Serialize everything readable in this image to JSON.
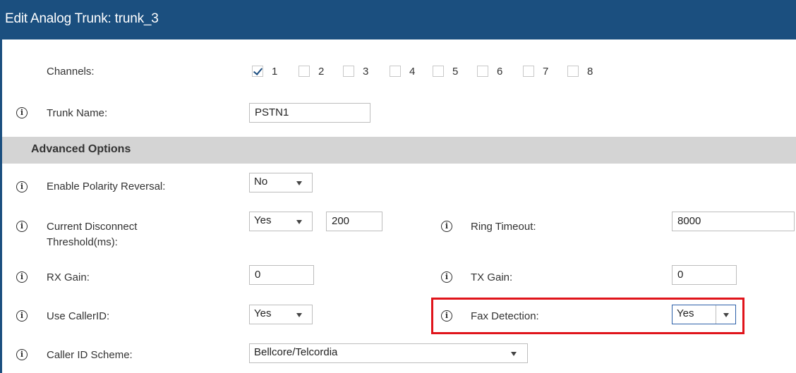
{
  "header": {
    "title": "Edit Analog Trunk: trunk_3"
  },
  "channels": {
    "label": "Channels:",
    "items": [
      {
        "num": "1",
        "checked": true
      },
      {
        "num": "2",
        "checked": false
      },
      {
        "num": "3",
        "checked": false
      },
      {
        "num": "4",
        "checked": false
      },
      {
        "num": "5",
        "checked": false
      },
      {
        "num": "6",
        "checked": false
      },
      {
        "num": "7",
        "checked": false
      },
      {
        "num": "8",
        "checked": false
      }
    ]
  },
  "trunk_name": {
    "label": "Trunk Name:",
    "value": "PSTN1"
  },
  "advanced": {
    "title": "Advanced Options"
  },
  "polarity": {
    "label": "Enable Polarity Reversal:",
    "value": "No"
  },
  "disconnect": {
    "label_line1": "Current Disconnect",
    "label_line2": "Threshold(ms):",
    "select_value": "Yes",
    "input_value": "200"
  },
  "ring_timeout": {
    "label": "Ring Timeout:",
    "value": "8000"
  },
  "rx_gain": {
    "label": "RX Gain:",
    "value": "0"
  },
  "tx_gain": {
    "label": "TX Gain:",
    "value": "0"
  },
  "callerid": {
    "label": "Use CallerID:",
    "value": "Yes"
  },
  "fax": {
    "label": "Fax Detection:",
    "value": "Yes"
  },
  "caller_scheme": {
    "label": "Caller ID Scheme:",
    "value": "Bellcore/Telcordia"
  },
  "icons": {
    "info": "info-icon",
    "dropdown": "chevron-down-icon",
    "check": "checkmark-icon"
  },
  "colors": {
    "header_bg": "#1b4f7f",
    "section_bg": "#d4d4d4",
    "highlight": "#e0141b"
  }
}
